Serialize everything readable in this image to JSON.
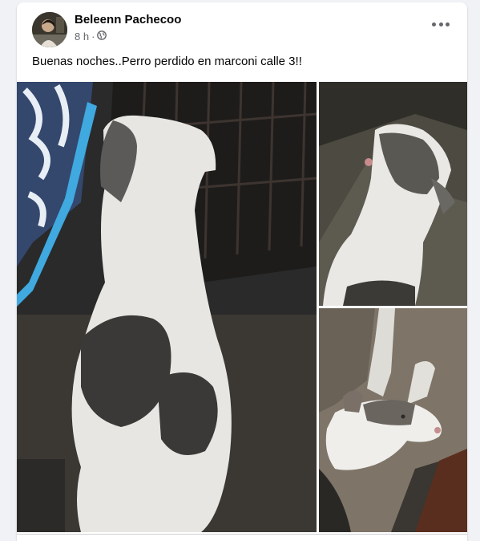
{
  "post": {
    "author": "Beleenn Pachecoo",
    "time": "8 h",
    "separator": "·",
    "privacy_icon": "globe-icon",
    "text": "Buenas noches..Perro perdido en marconi calle 3!!",
    "more_icon": "more-options-icon"
  },
  "photos": [
    {
      "subject": "dog-photo-back"
    },
    {
      "subject": "dog-photo-side"
    },
    {
      "subject": "dog-photo-face"
    }
  ],
  "colors": {
    "background": "#f0f2f5",
    "card": "#ffffff",
    "text": "#050505",
    "secondary_text": "#65676b"
  }
}
